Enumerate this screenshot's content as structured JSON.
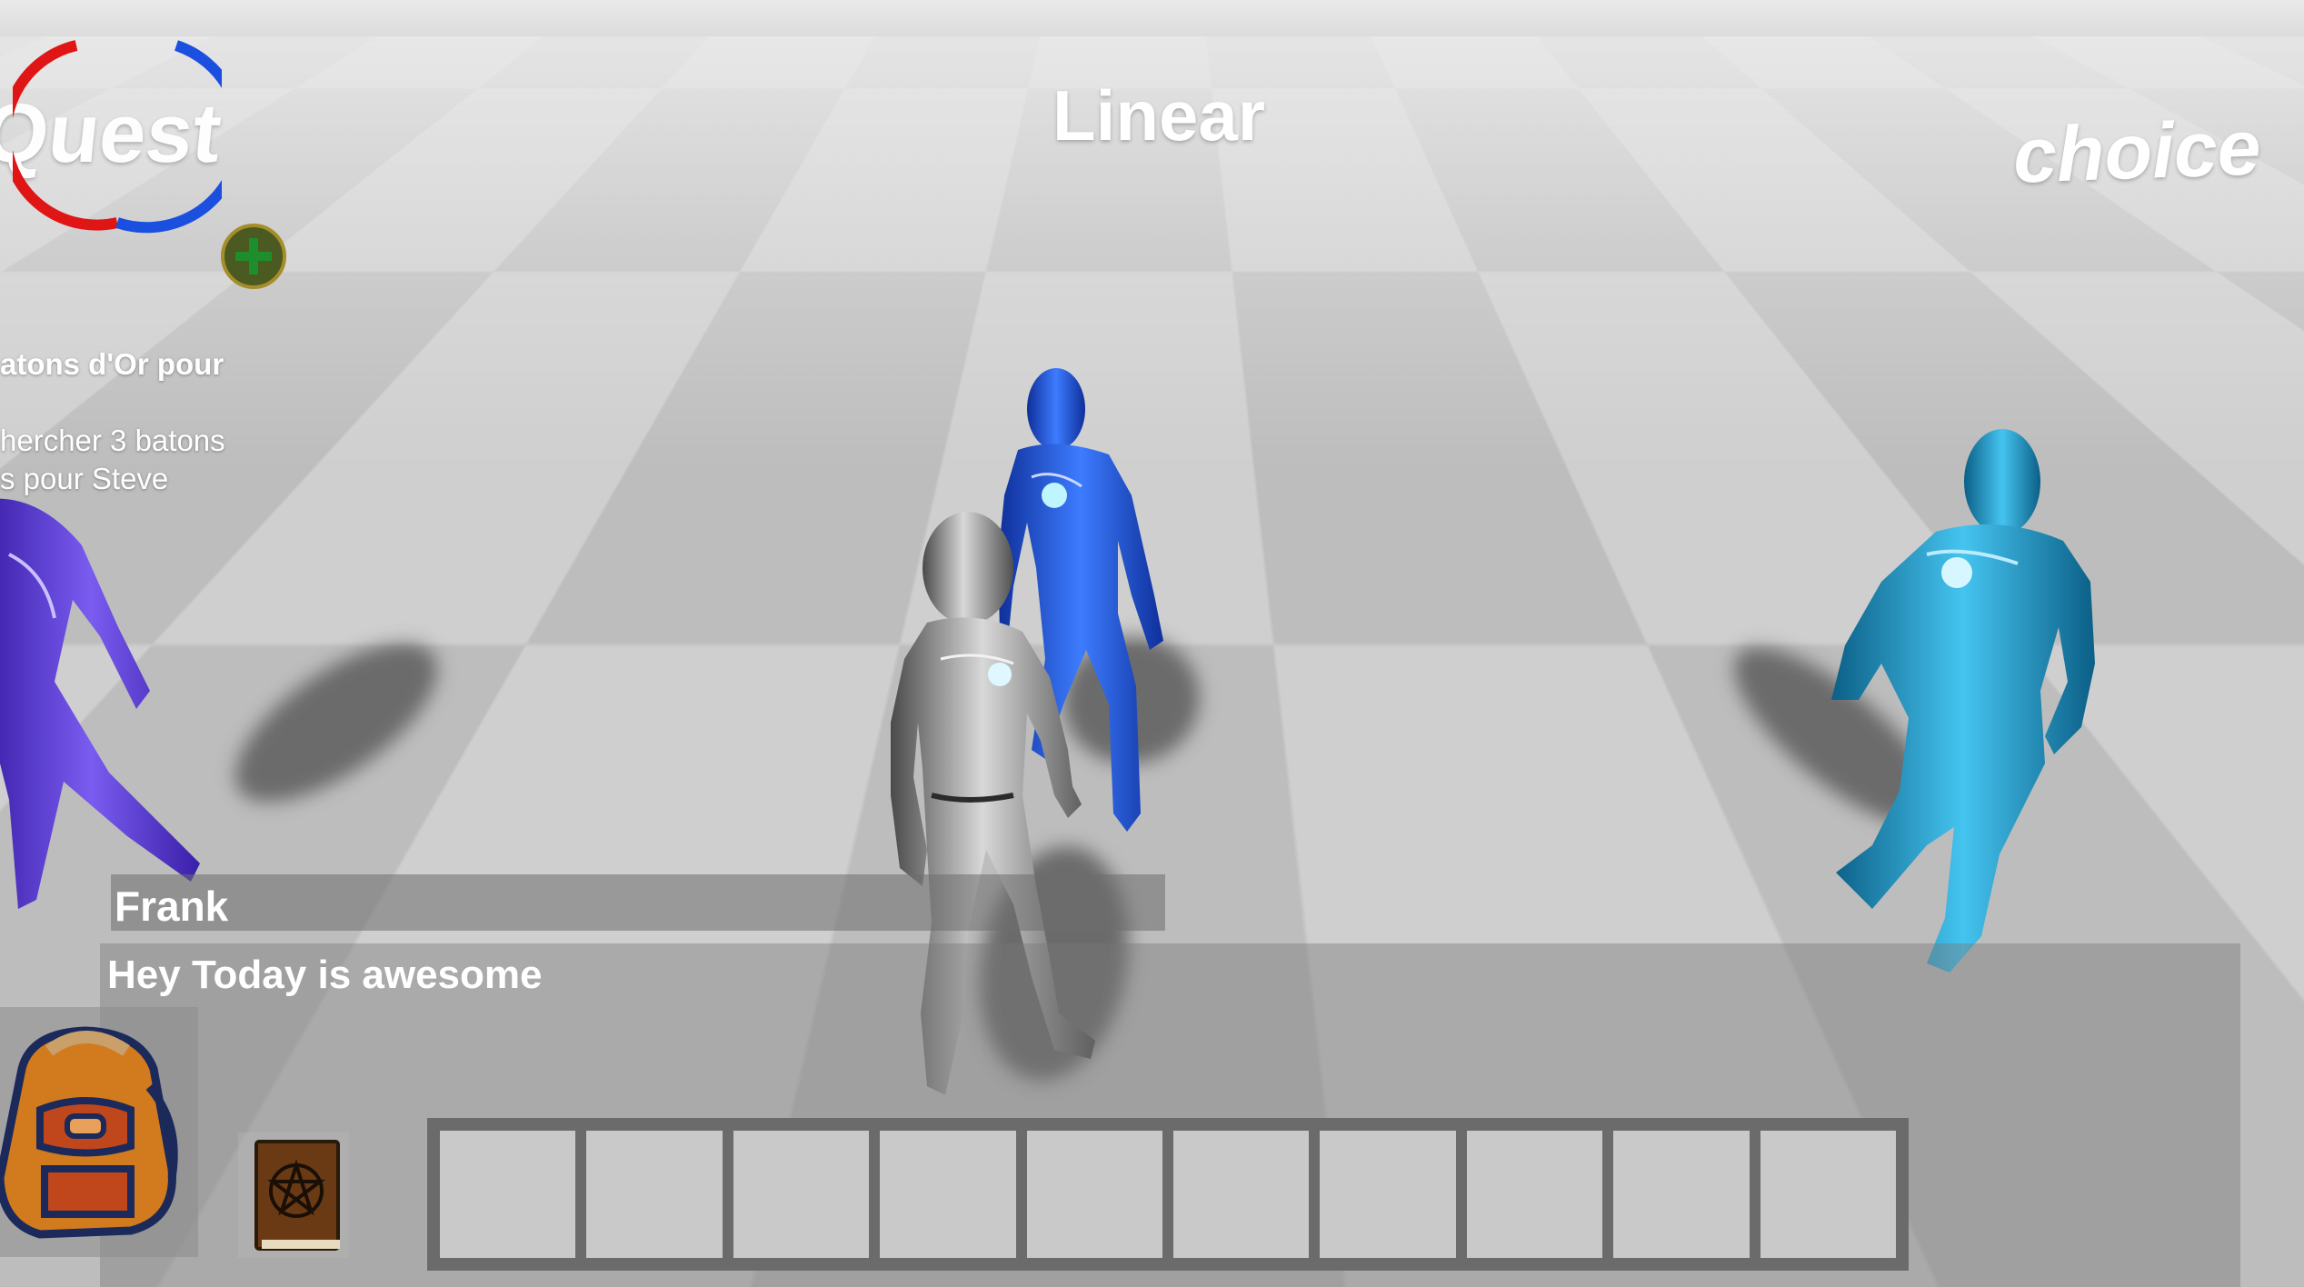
{
  "world_labels": {
    "quest": "Quest",
    "linear": "Linear",
    "choice": "choice"
  },
  "quest_log": {
    "title_fragment": "atons d'Or pour",
    "line1_fragment": "hercher 3 batons",
    "line2_fragment": "s pour Steve"
  },
  "dialog": {
    "speaker": "Frank",
    "message": "Hey Today is awesome"
  },
  "hud": {
    "ring_colors": {
      "left": "#e01515",
      "right": "#1a4fe0"
    },
    "add_button_icon": "plus-circle-icon",
    "backpack_icon": "backpack-icon",
    "book_icon": "spellbook-icon"
  },
  "hotbar": {
    "slots": [
      "",
      "",
      "",
      "",
      "",
      "",
      "",
      "",
      "",
      ""
    ]
  },
  "characters": [
    {
      "name": "purple-mannequin",
      "color": "#5b3bd6"
    },
    {
      "name": "blue-mannequin",
      "color": "#1e53d8"
    },
    {
      "name": "silver-mannequin",
      "color": "#9a9a9a"
    },
    {
      "name": "cyan-mannequin",
      "color": "#1fa3d6"
    }
  ]
}
